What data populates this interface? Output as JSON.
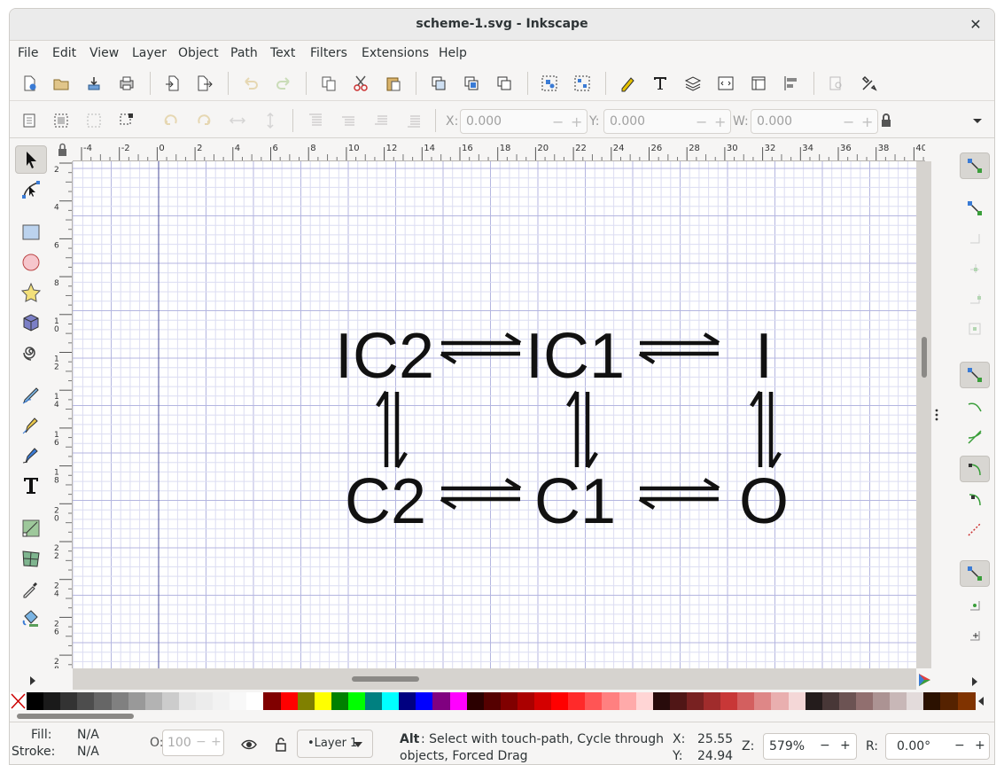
{
  "window": {
    "title": "scheme-1.svg - Inkscape",
    "close_glyph": "✕"
  },
  "menu": [
    "File",
    "Edit",
    "View",
    "Layer",
    "Object",
    "Path",
    "Text",
    "Filters",
    "Extensions",
    "Help"
  ],
  "toolbar2": {
    "x_label": "X:",
    "x_value": "0.000",
    "y_label": "Y:",
    "y_value": "0.000",
    "w_label": "W:",
    "w_value": "0.000",
    "minus": "−",
    "plus": "+"
  },
  "ruler": {
    "top_labels": [
      "-4",
      "-2",
      "0",
      "2",
      "4",
      "6",
      "8",
      "10",
      "12",
      "14",
      "16",
      "18",
      "20",
      "22",
      "24",
      "26",
      "28",
      "30",
      "32",
      "34",
      "36",
      "38",
      "40"
    ],
    "left_labels": [
      "2",
      "4",
      "6",
      "8",
      "1\n0",
      "1\n2",
      "1\n4",
      "1\n6",
      "1\n8",
      "2\n0",
      "2\n2",
      "2\n4",
      "2\n6",
      "2\n8"
    ]
  },
  "drawing": {
    "row1": [
      "IC2",
      "IC1",
      "I"
    ],
    "row2": [
      "C2",
      "C1",
      "O"
    ]
  },
  "palette": [
    "#000000",
    "#1a1a1a",
    "#333333",
    "#4d4d4d",
    "#666666",
    "#808080",
    "#999999",
    "#b3b3b3",
    "#cccccc",
    "#e6e6e6",
    "#ececec",
    "#f2f2f2",
    "#f8f8f8",
    "#ffffff",
    "#800000",
    "#ff0000",
    "#808000",
    "#ffff00",
    "#008000",
    "#00ff00",
    "#008080",
    "#00ffff",
    "#000080",
    "#0000ff",
    "#800080",
    "#ff00ff",
    "#2b0000",
    "#550000",
    "#800000",
    "#aa0000",
    "#d40000",
    "#ff0000",
    "#ff2a2a",
    "#ff5555",
    "#ff8080",
    "#ffaaaa",
    "#ffd5d5",
    "#280b0b",
    "#501616",
    "#782121",
    "#a02c2c",
    "#c83737",
    "#d35f5f",
    "#de8787",
    "#e9afaf",
    "#f4d7d7",
    "#241c1c",
    "#483737",
    "#6c5353",
    "#916f6f",
    "#ac9393",
    "#c8b7b7",
    "#e3dbdb",
    "#2b1100",
    "#552200",
    "#803300"
  ],
  "status": {
    "fill_label": "Fill:",
    "fill_value": "N/A",
    "stroke_label": "Stroke:",
    "stroke_value": "N/A",
    "opacity_label": "O:",
    "opacity_value": "100",
    "layer": "•Layer 1",
    "hint_bold": "Alt",
    "hint_line1": ": Select with touch-path, Cycle through",
    "hint_line2": "objects, Forced Drag",
    "x_label": "X:",
    "x_value": "25.55",
    "y_label": "Y:",
    "y_value": "24.94",
    "zoom_label": "Z:",
    "zoom_value": "579%",
    "rot_label": "R:",
    "rot_value": "0.00°",
    "minus": "−",
    "plus": "+"
  }
}
